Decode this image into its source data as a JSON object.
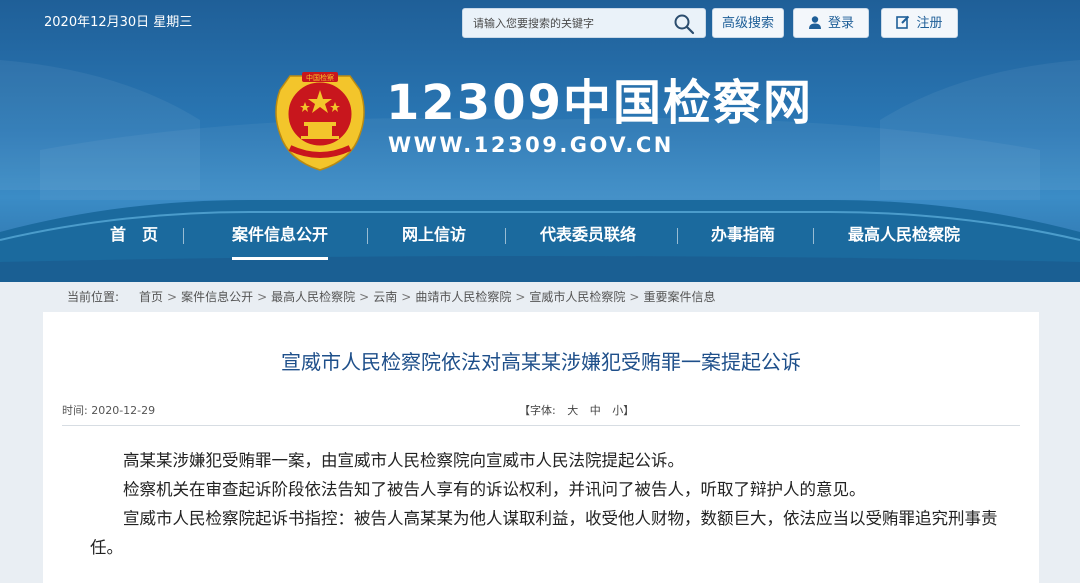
{
  "header": {
    "date": "2020年12月30日 星期三",
    "search": {
      "placeholder": "请输入您要搜索的关键字",
      "icon": "search-icon"
    },
    "advanced_search": "高级搜索",
    "login": "登录",
    "register": "注册",
    "site_title": "12309中国检察网",
    "site_url": "WWW.12309.GOV.CN",
    "emblem_text": "中国检察"
  },
  "nav": {
    "items": [
      {
        "label": "首　页",
        "active": false
      },
      {
        "label": "案件信息公开",
        "active": true
      },
      {
        "label": "网上信访",
        "active": false
      },
      {
        "label": "代表委员联络",
        "active": false
      },
      {
        "label": "办事指南",
        "active": false
      },
      {
        "label": "最高人民检察院",
        "active": false
      }
    ]
  },
  "breadcrumb": {
    "label": "当前位置:",
    "items": [
      "首页",
      "案件信息公开",
      "最高人民检察院",
      "云南",
      "曲靖市人民检察院",
      "宣威市人民检察院",
      "重要案件信息"
    ],
    "separator": ">"
  },
  "article": {
    "title": "宣威市人民检察院依法对高某某涉嫌犯受贿罪一案提起公诉",
    "time_label": "时间:",
    "time": "2020-12-29",
    "font_label": "【字体:",
    "font_large": "大",
    "font_medium": "中",
    "font_small": "小】",
    "paragraphs": [
      "　　高某某涉嫌犯受贿罪一案，由宣威市人民检察院向宣威市人民法院提起公诉。",
      "　　检察机关在审查起诉阶段依法告知了被告人享有的诉讼权利，并讯问了被告人，听取了辩护人的意见。",
      "　　宣威市人民检察院起诉书指控：被告人高某某为他人谋取利益，收受他人财物，数额巨大，依法应当以受贿罪追究刑事责任。"
    ]
  },
  "colors": {
    "banner": "#2a77b4",
    "title": "#1e4f8a",
    "emblem_red": "#c8161d",
    "emblem_gold": "#f3c52b"
  }
}
